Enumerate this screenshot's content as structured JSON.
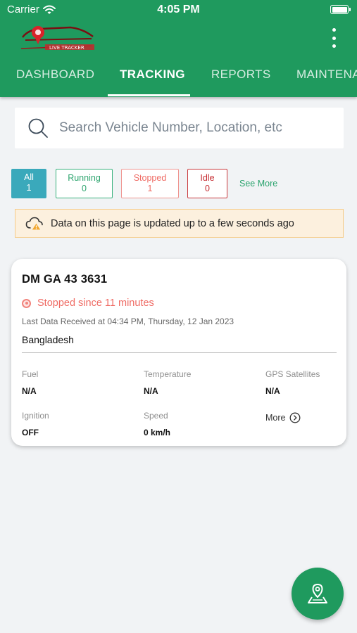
{
  "status_bar": {
    "carrier": "Carrier",
    "time": "4:05 PM"
  },
  "header": {
    "logo": {
      "text": "LIVE TRACKER"
    },
    "tabs": [
      {
        "label": "DASHBOARD"
      },
      {
        "label": "TRACKING"
      },
      {
        "label": "REPORTS"
      },
      {
        "label": "MAINTENA"
      }
    ],
    "active_tab": "TRACKING"
  },
  "search": {
    "placeholder": "Search Vehicle Number, Location, etc",
    "value": ""
  },
  "filters": [
    {
      "label": "All",
      "count": "1"
    },
    {
      "label": "Running",
      "count": "0"
    },
    {
      "label": "Stopped",
      "count": "1"
    },
    {
      "label": "Idle",
      "count": "0"
    }
  ],
  "see_more": "See More",
  "notice": {
    "text": "Data on this page is updated up to a few seconds ago",
    "icon": "cloud-warning-icon"
  },
  "vehicle_card": {
    "vehicle_number": "DM GA 43 3631",
    "status": "Stopped since 11 minutes",
    "last_data": "Last Data Received at 04:34 PM, Thursday, 12 Jan 2023",
    "location": "Bangladesh",
    "stats": [
      {
        "label": "Fuel",
        "value": "N/A"
      },
      {
        "label": "Temperature",
        "value": "N/A"
      },
      {
        "label": "GPS Satellites",
        "value": "N/A"
      },
      {
        "label": "Ignition",
        "value": "OFF"
      },
      {
        "label": "Speed",
        "value": "0 km/h"
      }
    ],
    "more_label": "More"
  },
  "colors": {
    "primary": "#1f9a5e",
    "all_filter": "#3aa9bb",
    "running": "#2ea56f",
    "stopped": "#ef6b64",
    "idle": "#c62c31",
    "notice_bg": "#fcf0de",
    "notice_border": "#f5cc8a"
  },
  "fab": {
    "icon": "map-pin-icon"
  }
}
